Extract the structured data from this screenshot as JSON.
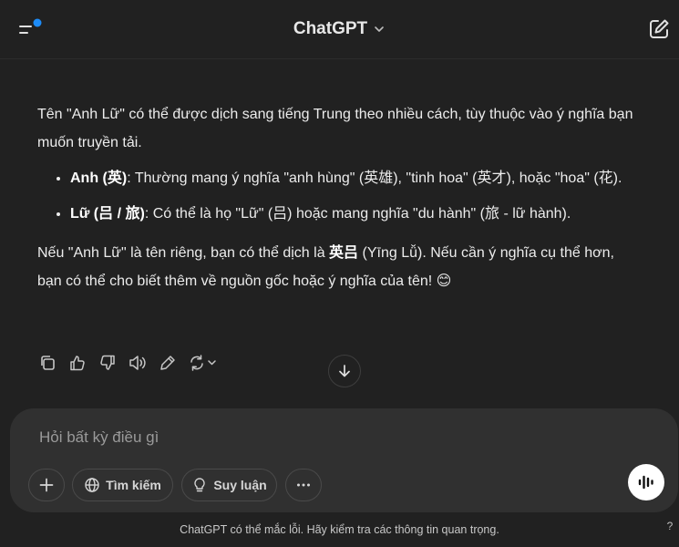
{
  "header": {
    "title": "ChatGPT",
    "notification_color": "#1d8cf8"
  },
  "message": {
    "para1": "Tên \"Anh Lữ\" có thể được dịch sang tiếng Trung theo nhiều cách, tùy thuộc vào ý nghĩa bạn muốn truyền tải.",
    "bullets": [
      {
        "term": "Anh (英)",
        "text": ": Thường mang ý nghĩa \"anh hùng\" (英雄), \"tinh hoa\" (英才), hoặc \"hoa\" (花)."
      },
      {
        "term": "Lữ (吕 / 旅)",
        "text": ": Có thể là họ \"Lữ\" (吕) hoặc mang nghĩa \"du hành\" (旅 - lữ hành)."
      }
    ],
    "para2_pre": "Nếu \"Anh Lữ\" là tên riêng, bạn có thể dịch là ",
    "para2_bold": "英吕",
    "para2_post": " (Yīng Lǚ). Nếu cần ý nghĩa cụ thể hơn, bạn có thể cho biết thêm về nguồn gốc hoặc ý nghĩa của tên! 😊"
  },
  "actions": {
    "icons": [
      "copy-icon",
      "thumbs-up-icon",
      "thumbs-down-icon",
      "speaker-icon",
      "edit-pencil-icon",
      "regenerate-icon"
    ]
  },
  "composer": {
    "placeholder": "Hỏi bất kỳ điều gì",
    "search_label": "Tìm kiếm",
    "reason_label": "Suy luận"
  },
  "footer": {
    "disclaimer": "ChatGPT có thể mắc lỗi. Hãy kiểm tra các thông tin quan trọng.",
    "help": "?"
  }
}
